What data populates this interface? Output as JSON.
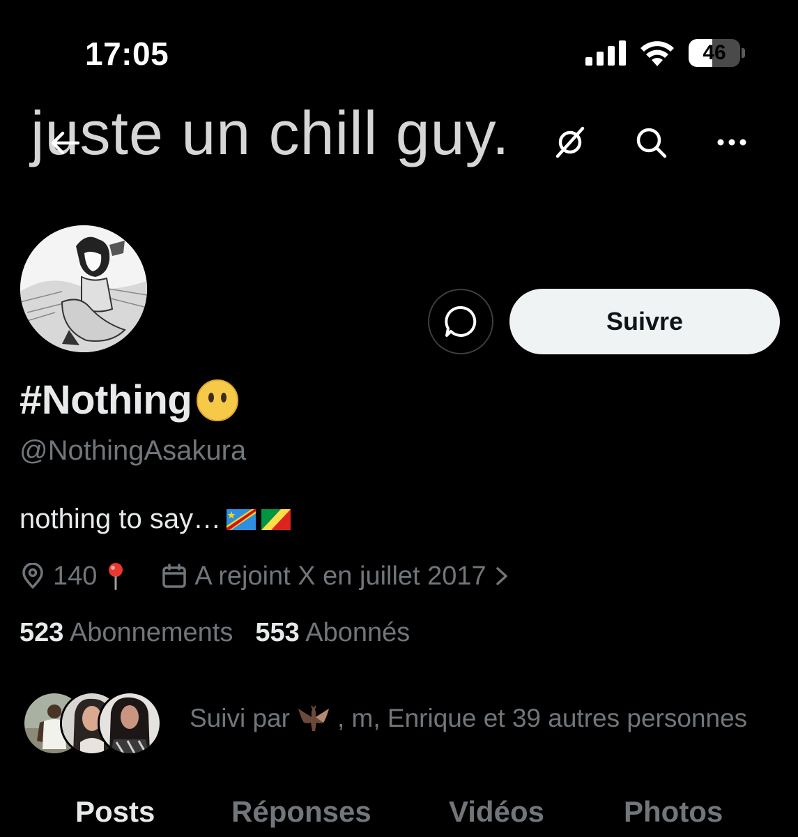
{
  "status_bar": {
    "time": "17:05",
    "battery_level": "46",
    "battery_fraction": 0.46,
    "icons": [
      "signal-icon",
      "wifi-icon",
      "battery-icon"
    ]
  },
  "header": {
    "banner_text": "juste un chill guy.",
    "icons": [
      "back-arrow-icon",
      "grok-icon",
      "search-icon",
      "more-icon"
    ]
  },
  "actions": {
    "follow_label": "Suivre",
    "message_icon": "message-bubble-icon"
  },
  "profile": {
    "display_name": "#Nothing",
    "name_emoji": "😶",
    "handle": "@NothingAsakura",
    "bio": "nothing to say…",
    "bio_flags": [
      "DR Congo flag",
      "Republic of the Congo flag"
    ],
    "location": "140",
    "location_emoji": "📍",
    "joined": "A rejoint X en juillet 2017"
  },
  "counts": {
    "following_num": "523",
    "following_label": "Abonnements",
    "followers_num": "553",
    "followers_label": "Abonnés"
  },
  "followed_by": {
    "prefix": "Suivi par",
    "emoji": "🦇",
    "rest": ", m, Enrique et 39 autres personnes"
  },
  "tabs": [
    {
      "label": "Posts",
      "active": true
    },
    {
      "label": "Réponses",
      "active": false
    },
    {
      "label": "Vidéos",
      "active": false
    },
    {
      "label": "Photos",
      "active": false
    }
  ],
  "colors": {
    "background": "#000000",
    "primary_text": "#e7e9ea",
    "secondary_text": "#71767b",
    "follow_button": "#eff3f4"
  }
}
